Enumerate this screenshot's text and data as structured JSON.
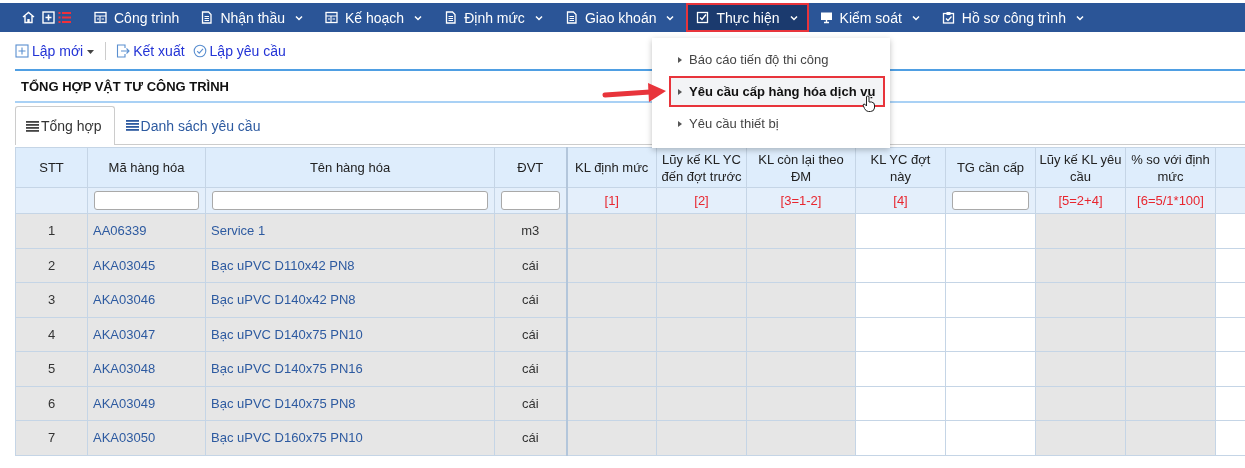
{
  "nav": {
    "items": [
      {
        "label": "Công trình",
        "has_caret": false,
        "selected": false
      },
      {
        "label": "Nhận thầu",
        "has_caret": true,
        "selected": false
      },
      {
        "label": "Kế hoạch",
        "has_caret": true,
        "selected": false
      },
      {
        "label": "Định mức",
        "has_caret": true,
        "selected": false
      },
      {
        "label": "Giao khoán",
        "has_caret": true,
        "selected": false
      },
      {
        "label": "Thực hiện",
        "has_caret": true,
        "selected": true
      },
      {
        "label": "Kiểm soát",
        "has_caret": true,
        "selected": false
      },
      {
        "label": "Hồ sơ công trình",
        "has_caret": true,
        "selected": false
      }
    ]
  },
  "dropdown": {
    "items": [
      {
        "label": "Báo cáo tiến độ thi công",
        "selected": false
      },
      {
        "label": "Yêu cầu cấp hàng hóa dịch vụ",
        "selected": true
      },
      {
        "label": "Yêu cầu thiết bị",
        "selected": false
      }
    ]
  },
  "toolbar": {
    "buttons": [
      {
        "label": "Lập mới",
        "has_menu": true
      },
      {
        "label": "Kết xuất",
        "has_menu": false
      },
      {
        "label": "Lập yêu cầu",
        "has_menu": false
      }
    ]
  },
  "title": "TỔNG HỢP VẬT TƯ CÔNG TRÌNH",
  "tabs": [
    {
      "label": "Tổng hợp",
      "selected": true
    },
    {
      "label": "Danh sách yêu cầu",
      "selected": false
    }
  ],
  "table": {
    "columns": [
      {
        "label": "STT",
        "editable": false
      },
      {
        "label": "Mã hàng hóa",
        "filter": {
          "kind": "input"
        },
        "editable": false
      },
      {
        "label": "Tên hàng hóa",
        "filter": {
          "kind": "input"
        },
        "editable": false
      },
      {
        "label": "ĐVT",
        "filter": {
          "kind": "input"
        },
        "editable": false
      },
      {
        "label": "KL định mức",
        "filter": {
          "kind": "formula",
          "text": "[1]"
        },
        "editable": false
      },
      {
        "label": "Lũy kế KL YC đến đợt trước",
        "filter": {
          "kind": "formula",
          "text": "[2]"
        },
        "editable": false
      },
      {
        "label": "KL còn lại theo ĐM",
        "filter": {
          "kind": "formula",
          "text": "[3=1-2]"
        },
        "editable": false
      },
      {
        "label": "KL YC đợt này",
        "filter": {
          "kind": "formula",
          "text": "[4]"
        },
        "editable": true
      },
      {
        "label": "TG cần cấp",
        "filter": {
          "kind": "input"
        },
        "editable": true
      },
      {
        "label": "Lũy kế KL yêu cầu",
        "filter": {
          "kind": "formula",
          "text": "[5=2+4]"
        },
        "editable": false
      },
      {
        "label": "% so với định mức",
        "filter": {
          "kind": "formula",
          "text": "[6=5/1*100]"
        },
        "editable": false
      },
      {
        "editable": true
      }
    ],
    "rows": [
      {
        "stt": "1",
        "code": "AA06339",
        "name": "Service 1",
        "unit": "m3"
      },
      {
        "stt": "2",
        "code": "AKA03045",
        "name": "Bạc uPVC D110x42 PN8",
        "unit": "cái"
      },
      {
        "stt": "3",
        "code": "AKA03046",
        "name": "Bạc uPVC D140x42 PN8",
        "unit": "cái"
      },
      {
        "stt": "4",
        "code": "AKA03047",
        "name": "Bạc uPVC D140x75 PN10",
        "unit": "cái"
      },
      {
        "stt": "5",
        "code": "AKA03048",
        "name": "Bạc uPVC D140x75 PN16",
        "unit": "cái"
      },
      {
        "stt": "6",
        "code": "AKA03049",
        "name": "Bạc uPVC D140x75 PN8",
        "unit": "cái"
      },
      {
        "stt": "7",
        "code": "AKA03050",
        "name": "Bạc uPVC D160x75 PN10",
        "unit": "cái"
      }
    ]
  }
}
